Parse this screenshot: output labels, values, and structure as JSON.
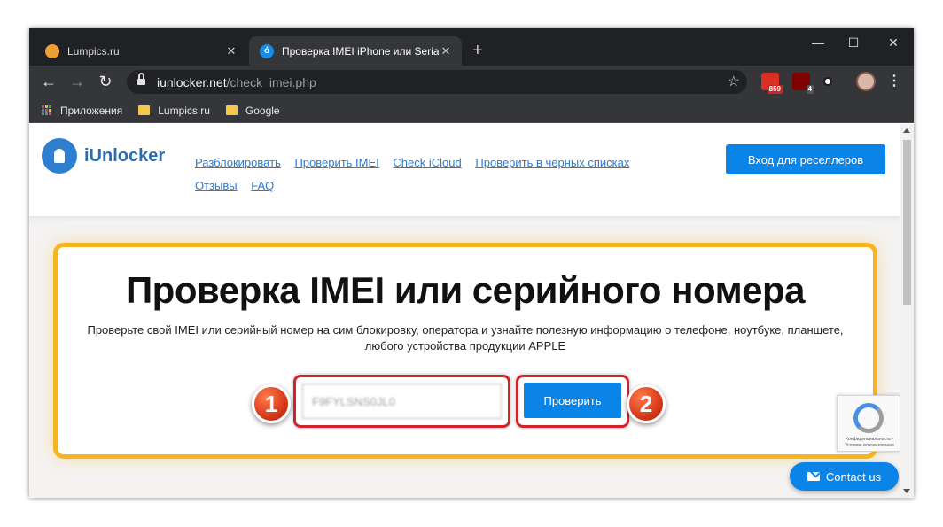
{
  "browser": {
    "tabs": [
      {
        "title": "Lumpics.ru",
        "favicon": "orange-circle-icon",
        "active": false
      },
      {
        "title": "Проверка IMEI iPhone или Serial",
        "favicon": "iunlocker-icon",
        "active": true
      }
    ],
    "new_tab": "+",
    "window_controls": {
      "minimize": "—",
      "maximize": "☐",
      "close": "✕"
    },
    "url_host": "iunlocker.net",
    "url_path": "/check_imei.php",
    "extensions": [
      {
        "name": "gmail-extension-icon",
        "badge": "859",
        "color": "#d93025"
      },
      {
        "name": "ublock-extension-icon",
        "badge": "4",
        "color": "#800000"
      },
      {
        "name": "eye-extension-icon",
        "badge": "",
        "color": "#ffffff"
      }
    ],
    "bookmarks": [
      {
        "label": "Приложения",
        "icon": "apps-grid-icon"
      },
      {
        "label": "Lumpics.ru",
        "icon": "folder-icon"
      },
      {
        "label": "Google",
        "icon": "folder-icon"
      }
    ]
  },
  "site": {
    "logo_text": "iUnlocker",
    "nav": [
      "Разблокировать",
      "Проверить IMEI",
      "Check iCloud",
      "Проверить в чёрных списках",
      "Отзывы",
      "FAQ"
    ],
    "reseller_button": "Вход для реселлеров",
    "heading": "Проверка IMEI или серийного номера",
    "subtitle_line1": "Проверьте свой IMEI или серийный номер на сим блокировку, оператора и узнайте полезную информацию о телефоне, ноутбуке, планшете,",
    "subtitle_line2": "любого устройства продукции APPLE",
    "imei_value": "F9FYLSNS0JL0",
    "check_button": "Проверить",
    "step1": "1",
    "step2": "2",
    "recaptcha_text": "Конфиденциальность - Условия использования",
    "contact_button": "Contact us"
  },
  "colors": {
    "accent": "#0b84e8",
    "card_border": "#f7b422",
    "highlight": "#d2232a"
  }
}
